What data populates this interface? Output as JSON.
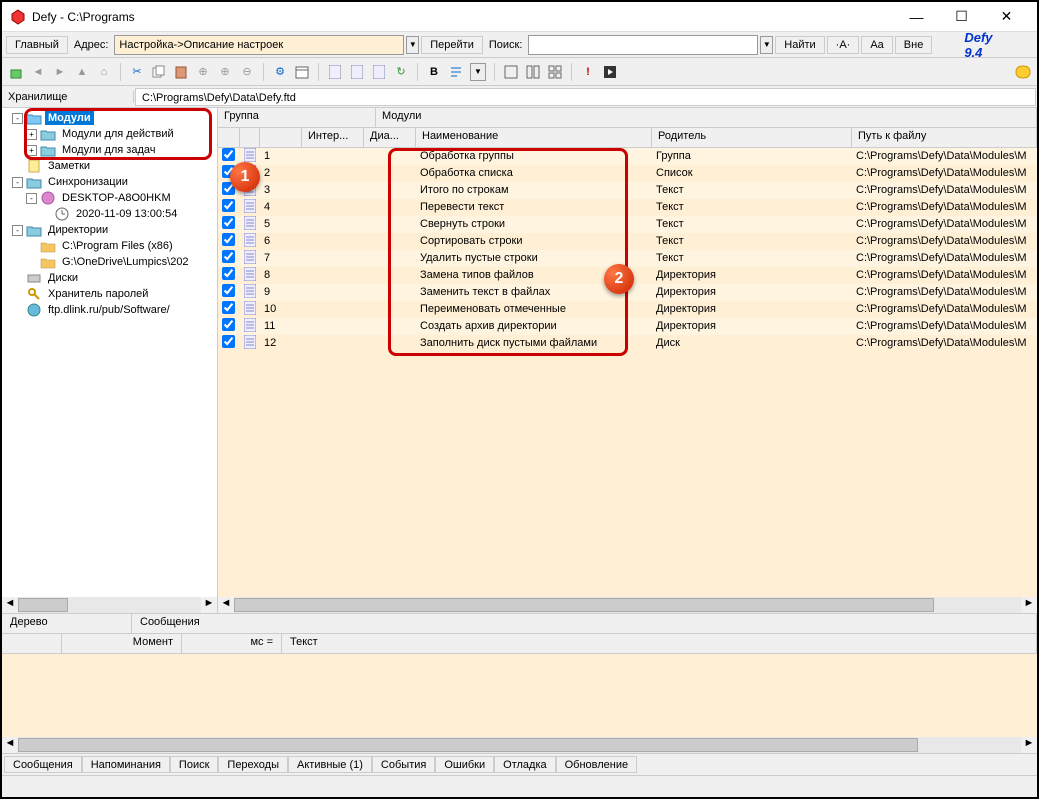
{
  "window": {
    "title": "Defy - C:\\Programs",
    "min": "—",
    "max": "☐",
    "close": "✕"
  },
  "addressbar": {
    "main_btn": "Главный",
    "addr_label": "Адрес:",
    "addr_value": "Настройка->Описание настроек",
    "go_btn": "Перейти",
    "search_label": "Поиск:",
    "search_value": "",
    "find_btn": "Найти",
    "fs1": "·A·",
    "fs2": "Aa",
    "fs3": "Вне",
    "brand": "Defy 9.4"
  },
  "pathbar": {
    "label": "Хранилище",
    "value": "C:\\Programs\\Defy\\Data\\Defy.ftd"
  },
  "tree": {
    "items": [
      {
        "indent": 0,
        "toggle": "-",
        "icon": "folder-open",
        "label": "Модули",
        "selected": true
      },
      {
        "indent": 1,
        "toggle": "+",
        "icon": "folder",
        "label": "Модули для действий"
      },
      {
        "indent": 1,
        "toggle": "+",
        "icon": "folder",
        "label": "Модули для задач"
      },
      {
        "indent": 0,
        "toggle": "",
        "icon": "note",
        "label": "Заметки"
      },
      {
        "indent": 0,
        "toggle": "-",
        "icon": "folder",
        "label": "Синхронизации"
      },
      {
        "indent": 1,
        "toggle": "-",
        "icon": "device",
        "label": "DESKTOP-A8O0HKM"
      },
      {
        "indent": 2,
        "toggle": "",
        "icon": "clock",
        "label": "2020-11-09 13:00:54"
      },
      {
        "indent": 0,
        "toggle": "-",
        "icon": "folder",
        "label": "Директории"
      },
      {
        "indent": 1,
        "toggle": "",
        "icon": "folder-y",
        "label": "C:\\Program Files (x86)"
      },
      {
        "indent": 1,
        "toggle": "",
        "icon": "folder-y",
        "label": "G:\\OneDrive\\Lumpics\\202"
      },
      {
        "indent": 0,
        "toggle": "",
        "icon": "disk",
        "label": "Диски"
      },
      {
        "indent": 0,
        "toggle": "",
        "icon": "keys",
        "label": "Хранитель паролей"
      },
      {
        "indent": 0,
        "toggle": "",
        "icon": "globe",
        "label": "ftp.dlink.ru/pub/Software/"
      }
    ]
  },
  "grid": {
    "group_label": "Группа",
    "group_value": "Модули",
    "headers": {
      "num": "",
      "inter": "Интер...",
      "dia": "Диа...",
      "name": "Наименование",
      "parent": "Родитель",
      "path": "Путь к файлу"
    },
    "rows": [
      {
        "n": "1",
        "name": "Обработка группы",
        "parent": "Группа",
        "path": "C:\\Programs\\Defy\\Data\\Modules\\M"
      },
      {
        "n": "2",
        "name": "Обработка списка",
        "parent": "Список",
        "path": "C:\\Programs\\Defy\\Data\\Modules\\M"
      },
      {
        "n": "3",
        "name": "Итого по строкам",
        "parent": "Текст",
        "path": "C:\\Programs\\Defy\\Data\\Modules\\M"
      },
      {
        "n": "4",
        "name": "Перевести текст",
        "parent": "Текст",
        "path": "C:\\Programs\\Defy\\Data\\Modules\\M"
      },
      {
        "n": "5",
        "name": "Свернуть строки",
        "parent": "Текст",
        "path": "C:\\Programs\\Defy\\Data\\Modules\\M"
      },
      {
        "n": "6",
        "name": "Сортировать строки",
        "parent": "Текст",
        "path": "C:\\Programs\\Defy\\Data\\Modules\\M"
      },
      {
        "n": "7",
        "name": "Удалить пустые строки",
        "parent": "Текст",
        "path": "C:\\Programs\\Defy\\Data\\Modules\\M"
      },
      {
        "n": "8",
        "name": "Замена типов файлов",
        "parent": "Директория",
        "path": "C:\\Programs\\Defy\\Data\\Modules\\M"
      },
      {
        "n": "9",
        "name": "Заменить текст в файлах",
        "parent": "Директория",
        "path": "C:\\Programs\\Defy\\Data\\Modules\\M"
      },
      {
        "n": "10",
        "name": "Переименовать отмеченные",
        "parent": "Директория",
        "path": "C:\\Programs\\Defy\\Data\\Modules\\M"
      },
      {
        "n": "11",
        "name": "Создать архив директории",
        "parent": "Директория",
        "path": "C:\\Programs\\Defy\\Data\\Modules\\M"
      },
      {
        "n": "12",
        "name": "Заполнить диск пустыми файлами",
        "parent": "Диск",
        "path": "C:\\Programs\\Defy\\Data\\Modules\\M"
      }
    ]
  },
  "log": {
    "tab1": "Дерево",
    "tab2": "Сообщения",
    "h1": "Момент",
    "h2": "мс =",
    "h3": "Текст"
  },
  "status_tabs": [
    "Сообщения",
    "Напоминания",
    "Поиск",
    "Переходы",
    "Активные (1)",
    "События",
    "Ошибки",
    "Отладка",
    "Обновление"
  ],
  "callouts": {
    "c1": "1",
    "c2": "2"
  }
}
